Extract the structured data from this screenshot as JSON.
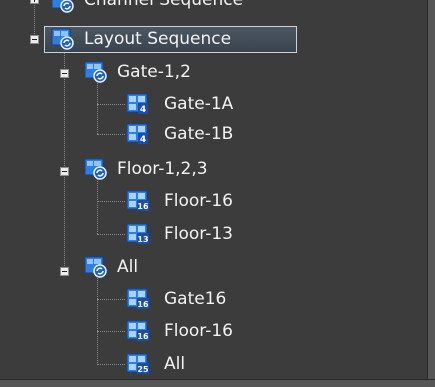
{
  "tree": {
    "items": [
      {
        "label": "Channel Sequence",
        "icon": "sequence-icon",
        "expanded": false
      },
      {
        "label": "Layout Sequence",
        "icon": "sequence-icon",
        "expanded": true,
        "selected": true
      },
      {
        "label": "Gate-1,2",
        "icon": "sequence-icon",
        "expanded": true
      },
      {
        "label": "Gate-1A",
        "icon": "layout-4-icon",
        "badge": "4"
      },
      {
        "label": "Gate-1B",
        "icon": "layout-4-icon",
        "badge": "4"
      },
      {
        "label": "Floor-1,2,3",
        "icon": "sequence-icon",
        "expanded": true
      },
      {
        "label": "Floor-16",
        "icon": "layout-16-icon",
        "badge": "16"
      },
      {
        "label": "Floor-13",
        "icon": "layout-13-icon",
        "badge": "13"
      },
      {
        "label": "All",
        "icon": "sequence-icon",
        "expanded": true
      },
      {
        "label": "Gate16",
        "icon": "layout-16-icon",
        "badge": "16"
      },
      {
        "label": "Floor-16",
        "icon": "layout-16-icon",
        "badge": "16"
      },
      {
        "label": "All",
        "icon": "layout-25-icon",
        "badge": "25"
      }
    ]
  },
  "colors": {
    "background": "#3c3c3c",
    "text": "#f3f3f3",
    "icon_blue": "#2f7fe0",
    "icon_dark": "#163f8f",
    "selection_border": "#c9d0d6"
  }
}
